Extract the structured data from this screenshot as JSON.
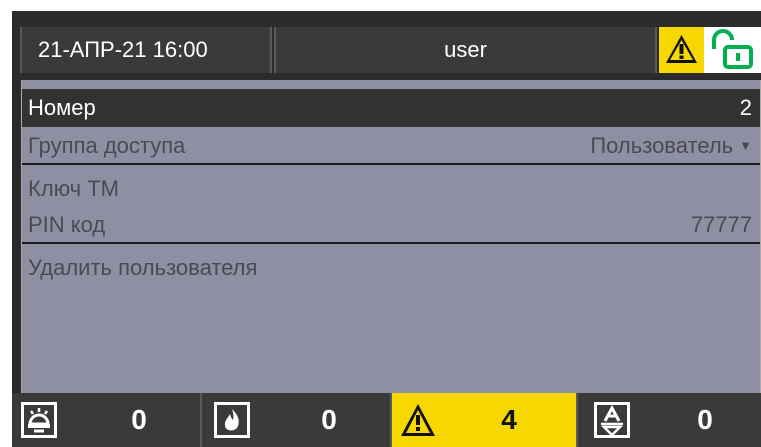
{
  "header": {
    "datetime": "21-АПР-21  16:00",
    "user": "user",
    "warning_icon": "warning-icon",
    "lock_icon": "unlock-icon"
  },
  "menu": {
    "items": [
      {
        "label": "Номер",
        "value": "2"
      },
      {
        "label": "Группа доступа",
        "value": "Пользователь"
      },
      {
        "label": "Ключ ТМ",
        "value": ""
      },
      {
        "label": "PIN код",
        "value": "77777"
      },
      {
        "label": "Удалить пользователя",
        "value": ""
      }
    ]
  },
  "status_bar": {
    "counters": [
      {
        "icon": "alarm-icon",
        "value": "0"
      },
      {
        "icon": "fire-icon",
        "value": "0"
      },
      {
        "icon": "warning-icon",
        "value": "4"
      },
      {
        "icon": "fault-icon",
        "value": "0"
      }
    ]
  },
  "colors": {
    "accent_yellow": "#f7d700",
    "lock_green": "#00b050",
    "list_bg": "#8f8fa3",
    "selected_bg": "#323232"
  }
}
